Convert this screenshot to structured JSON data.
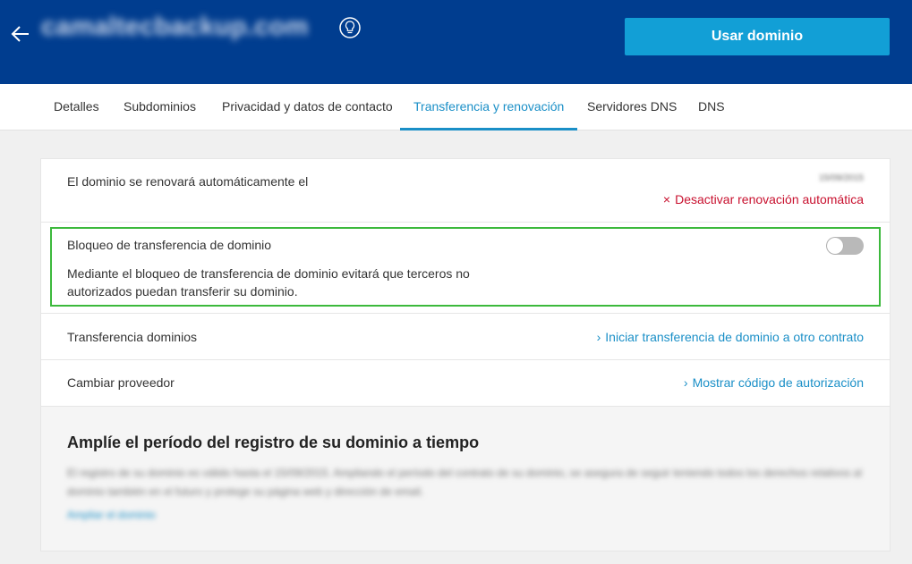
{
  "header": {
    "domain_name": "camaltecbackup.com",
    "use_domain_label": "Usar dominio",
    "back_icon": "arrow-left-icon",
    "tip_icon": "lightbulb-icon"
  },
  "tabs": [
    {
      "label": "Detalles",
      "active": false
    },
    {
      "label": "Subdominios",
      "active": false
    },
    {
      "label": "Privacidad y datos de contacto",
      "active": false
    },
    {
      "label": "Transferencia y renovación",
      "active": true
    },
    {
      "label": "Servidores DNS",
      "active": false
    },
    {
      "label": "DNS",
      "active": false
    }
  ],
  "renewal": {
    "label": "El dominio se renovará automáticamente el",
    "date": "15/09/2015",
    "deactivate_label": "Desactivar renovación automática"
  },
  "transfer_lock": {
    "label": "Bloqueo de transferencia de dominio",
    "description": "Mediante el bloqueo de transferencia de dominio evitará que terceros no autorizados puedan transferir su dominio.",
    "enabled": false
  },
  "transfer": {
    "label": "Transferencia dominios",
    "link": "Iniciar transferencia de dominio a otro contrato"
  },
  "provider": {
    "label": "Cambiar proveedor",
    "link": "Mostrar código de autorización"
  },
  "extend": {
    "title": "Amplíe el período del registro de su dominio a tiempo",
    "text": "El registro de su dominio es válido hasta el 15/09/2015. Ampliando el período del contrato de su dominio, se asegura de seguir teniendo todos los derechos relativos al dominio también en el futuro y protege su página web y dirección de email.",
    "link": "Ampliar el dominio"
  },
  "colors": {
    "header_bg": "#003d8f",
    "accent": "#129fd6",
    "link": "#1a8fc7",
    "danger": "#c8102e",
    "highlight": "#3cb93c"
  }
}
